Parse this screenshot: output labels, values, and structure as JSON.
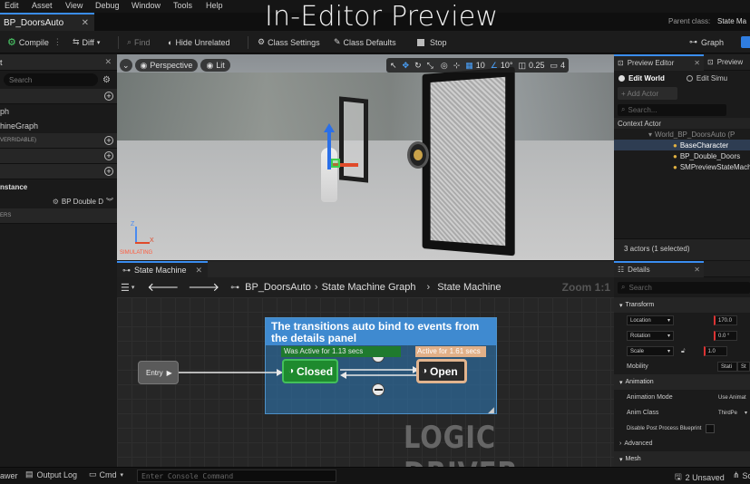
{
  "menu": [
    "Edit",
    "Asset",
    "View",
    "Debug",
    "Window",
    "Tools",
    "Help"
  ],
  "banner": "In-Editor Preview",
  "doc_tab": "BP_DoorsAuto",
  "parent_class_label": "Parent class:",
  "parent_class_value": "State Ma",
  "toolbar": {
    "compile": "Compile",
    "diff": "Diff",
    "find": "Find",
    "hide_unrelated": "Hide Unrelated",
    "class_settings": "Class Settings",
    "class_defaults": "Class Defaults",
    "stop": "Stop",
    "graph": "Graph"
  },
  "left_panel": {
    "tab_label": "t",
    "search_placeholder": "Search",
    "items": [
      "ph",
      "hineGraph"
    ],
    "overridable": "VERRIDABLE)",
    "instance_label": "nstance",
    "instance_value": "BP Double D",
    "ers": "ERS"
  },
  "viewport": {
    "perspective": "Perspective",
    "lit": "Lit",
    "grid_value": "10",
    "angle_value": "10°",
    "scale_value": "0.25",
    "cam_value": "4",
    "simulating": "SIMULATING"
  },
  "preview_editor": {
    "tab": "Preview Editor",
    "tab2": "Preview",
    "edit_world": "Edit World",
    "edit_sim": "Edit Simu",
    "add_actor": "+ Add Actor",
    "search_placeholder": "Search...",
    "column": "Context Actor",
    "world_item": "World_BP_DoorsAuto (P",
    "actors": [
      "BaseCharacter",
      "BP_Double_Doors",
      "SMPreviewStateMach"
    ],
    "count": "3 actors (1 selected)"
  },
  "graph": {
    "tab": "State Machine",
    "breadcrumb": [
      "BP_DoorsAuto",
      "State Machine Graph",
      "State Machine"
    ],
    "zoom": "Zoom 1:1",
    "comment": "The transitions auto bind to events from the details panel",
    "closed_status": "Was Active for 1.13 secs",
    "open_status": "Active for 1.61 secs",
    "entry": "Entry",
    "closed": "Closed",
    "open": "Open",
    "watermark": "LOGIC DRIVER"
  },
  "details": {
    "tab": "Details",
    "search_placeholder": "Search",
    "transform": "Transform",
    "location": "Location",
    "location_val": "170.0",
    "rotation": "Rotation",
    "rotation_val": "0.0 °",
    "scale": "Scale",
    "scale_val": "1.0",
    "mobility": "Mobility",
    "mobility_val1": "Stati",
    "mobility_val2": "St",
    "animation": "Animation",
    "anim_mode": "Animation Mode",
    "anim_mode_val": "Use Animat",
    "anim_class": "Anim Class",
    "anim_class_val": "ThirdPe",
    "disable_post": "Disable Post Process Blueprint",
    "advanced": "Advanced",
    "mesh": "Mesh"
  },
  "status": {
    "drawer": "awer",
    "output_log": "Output Log",
    "cmd": "Cmd",
    "console_placeholder": "Enter Console Command",
    "unsaved": "2 Unsaved",
    "sc": "Sc"
  },
  "colors": {
    "accent": "#3a8df0",
    "closed_node": "#1e8a2e",
    "open_node": "#e2b48e",
    "comment": "#3f8ad0"
  }
}
